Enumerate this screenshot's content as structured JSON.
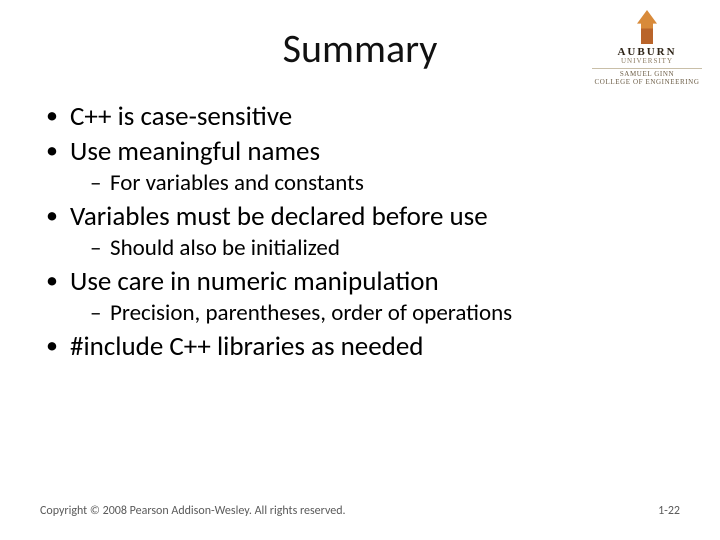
{
  "logo": {
    "university": "AUBURN",
    "tagline": "UNIVERSITY",
    "college_line1": "SAMUEL GINN",
    "college_line2": "COLLEGE OF ENGINEERING"
  },
  "title": "Summary",
  "bullets": {
    "b1": "C++ is case-sensitive",
    "b2": "Use meaningful names",
    "b2_sub1": "For variables and constants",
    "b3": "Variables must be declared before use",
    "b3_sub1": "Should also be initialized",
    "b4": "Use care in numeric manipulation",
    "b4_sub1": "Precision, parentheses, order of operations",
    "b5": "#include C++ libraries as needed"
  },
  "footer": {
    "copyright": "Copyright © 2008 Pearson Addison-Wesley. All rights reserved.",
    "pagenum": "1-22"
  }
}
